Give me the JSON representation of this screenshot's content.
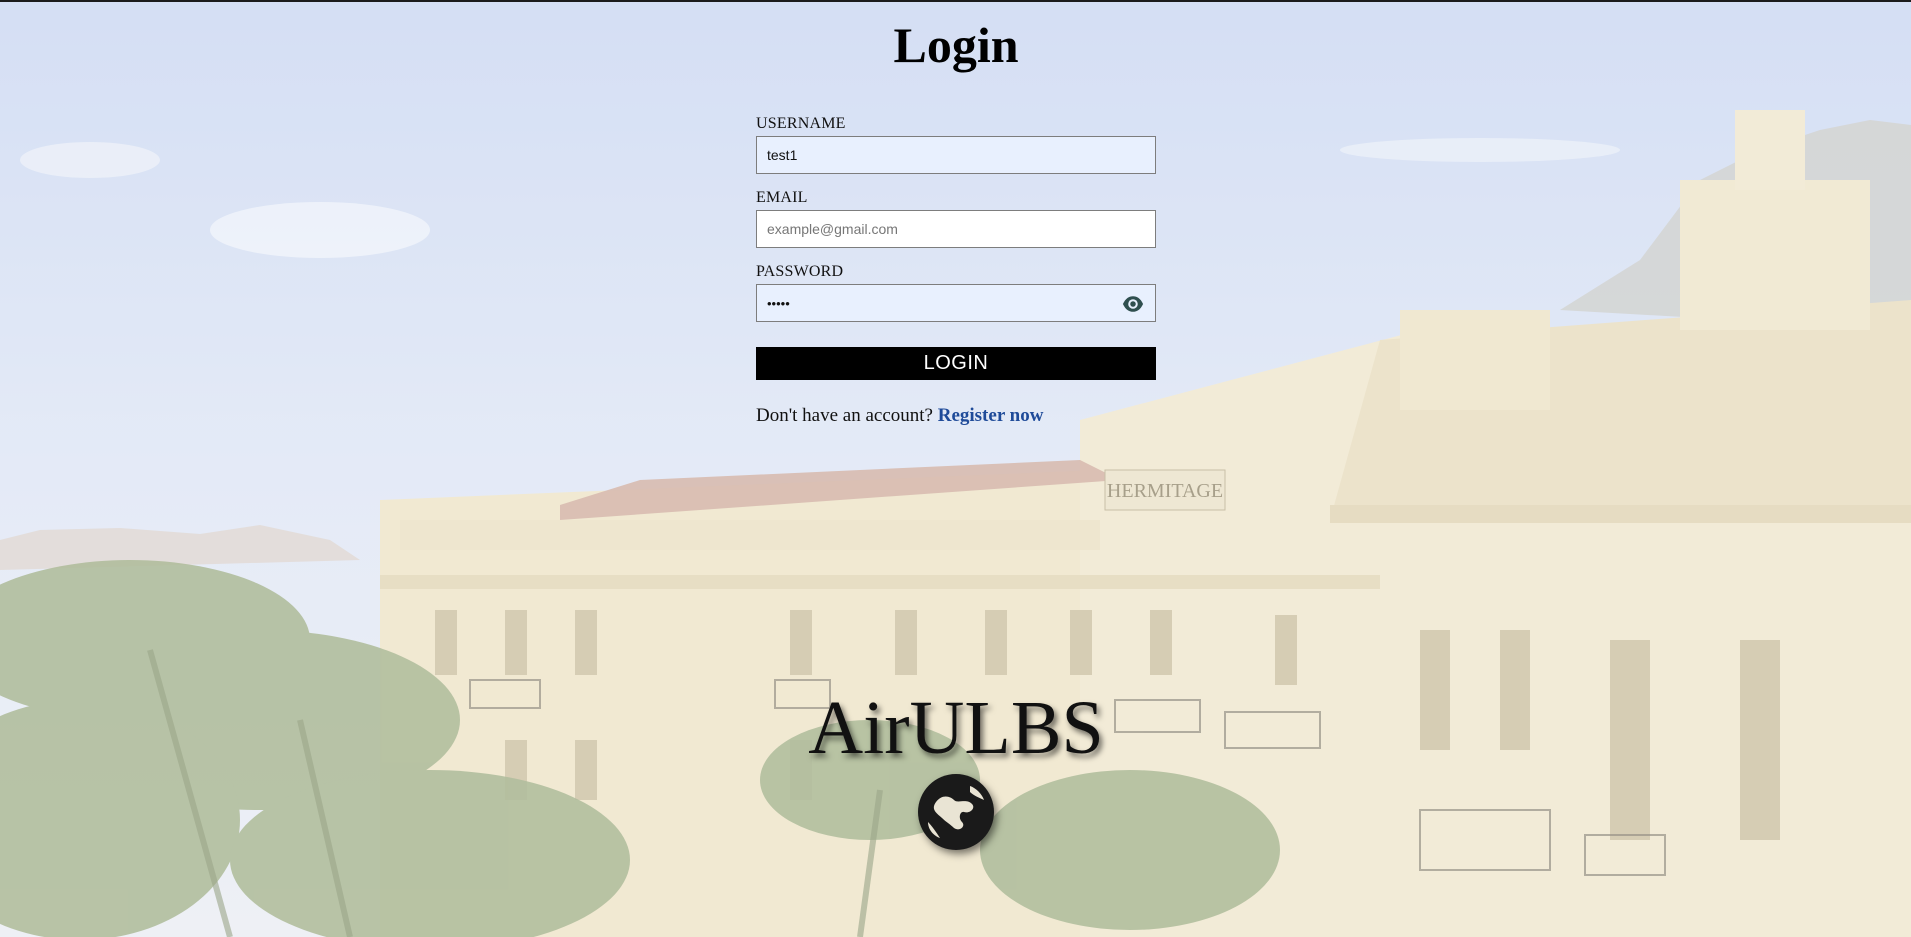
{
  "page": {
    "title": "Login"
  },
  "form": {
    "username_label": "USERNAME",
    "username_value": "test1",
    "email_label": "EMAIL",
    "email_placeholder": "example@gmail.com",
    "password_label": "PASSWORD",
    "password_value": "•••••",
    "login_button": "LOGIN",
    "register_prompt": "Don't have an account?",
    "register_link": "Register now",
    "toggle_icon": "eye-icon"
  },
  "brand": {
    "name": "AirULBS",
    "logo_icon": "globe-icon"
  },
  "background": {
    "sign_text": "HERMITAGE"
  },
  "colors": {
    "button_bg": "#000000",
    "link": "#1f4b99",
    "field_autofill": "#e8f0fe"
  }
}
